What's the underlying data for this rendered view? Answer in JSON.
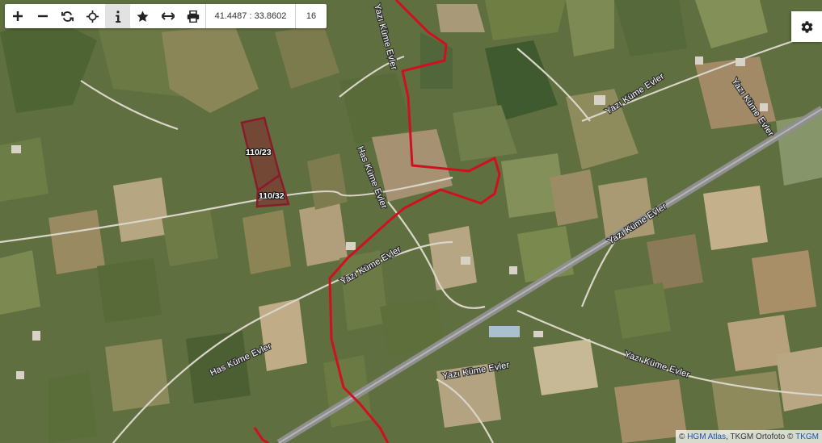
{
  "toolbar": {
    "buttons": [
      {
        "name": "zoom-in-button",
        "icon": "plus-icon"
      },
      {
        "name": "zoom-out-button",
        "icon": "minus-icon"
      },
      {
        "name": "refresh-button",
        "icon": "refresh-icon"
      },
      {
        "name": "locate-button",
        "icon": "crosshair-icon"
      },
      {
        "name": "info-button",
        "icon": "info-icon",
        "active": true
      },
      {
        "name": "favorite-button",
        "icon": "star-icon"
      },
      {
        "name": "measure-button",
        "icon": "measure-arrows-icon"
      },
      {
        "name": "print-button",
        "icon": "printer-icon"
      }
    ],
    "coordinates": "41.4487 : 33.8602",
    "zoom_level": "16"
  },
  "settings": {
    "icon": "gear-icon"
  },
  "map": {
    "layer": "satellite-orthophoto",
    "parcels": [
      {
        "label": "110/23"
      },
      {
        "label": "110/32"
      }
    ],
    "road_labels": [
      {
        "text": "Yazı Küme Evler"
      },
      {
        "text": "Has Küme Evler"
      },
      {
        "text": "Yazı Küme Evler"
      },
      {
        "text": "Yazı Küme Evler"
      },
      {
        "text": "Yazı Küme Evler"
      },
      {
        "text": "Yazı Küme Evler"
      },
      {
        "text": "Has Küme Evler"
      },
      {
        "text": "Yazı Küme Evler"
      }
    ],
    "colors": {
      "parcel": "#8b1a2b",
      "boundary": "#d01020",
      "road": "#d9d5c8",
      "highway": "#9a9a9a"
    }
  },
  "attribution": {
    "copyright": "©",
    "hgm": "HGM Atlas",
    "middle": ", TKGM Ortofoto ©",
    "tkgm": "TKGM"
  }
}
